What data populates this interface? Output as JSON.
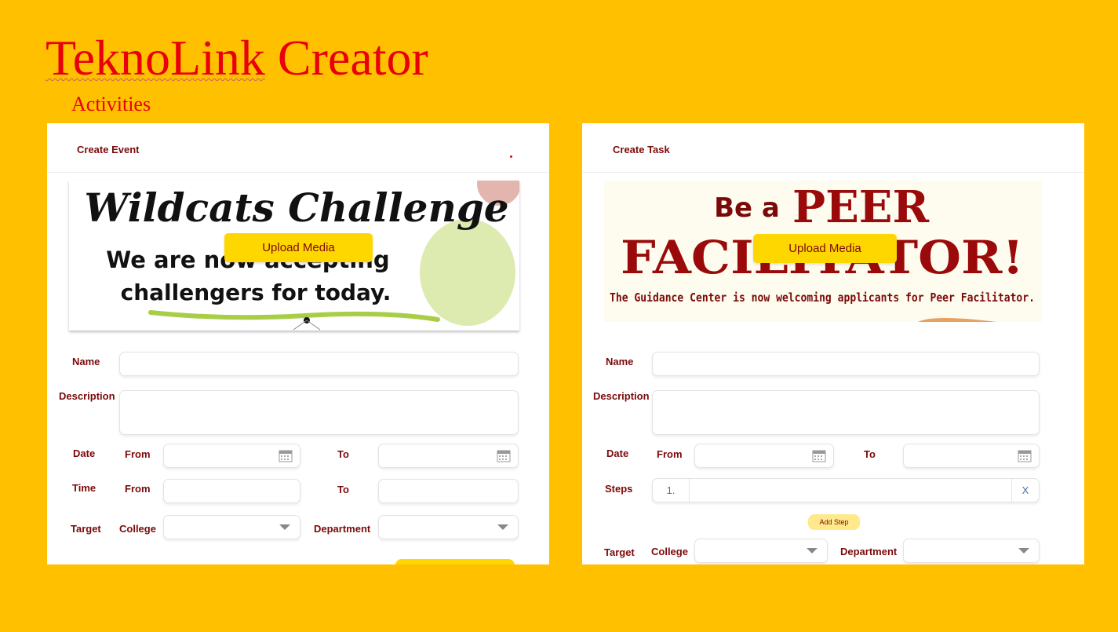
{
  "app": {
    "title_part1": "TeknoLink",
    "title_part2": " Creator",
    "section": "Activities"
  },
  "event_card": {
    "title": "Create Event",
    "banner": {
      "line1": "Wildcats Challenge",
      "line2": "We are now accepting",
      "line3": "challengers for today."
    },
    "upload_label": "Upload Media",
    "labels": {
      "name": "Name",
      "description": "Description",
      "date": "Date",
      "time": "Time",
      "from": "From",
      "to": "To",
      "target": "Target",
      "college": "College",
      "department": "Department"
    },
    "inputs": {
      "name": "",
      "description": "",
      "date_from": "",
      "date_to": "",
      "time_from": "",
      "time_to": "",
      "college": "",
      "department": ""
    }
  },
  "task_card": {
    "title": "Create Task",
    "banner": {
      "be_a": "Be a",
      "peer": "PEER",
      "facilitator": "FACILITATOR!",
      "subtitle": "The Guidance Center is now welcoming applicants for Peer Facilitator."
    },
    "upload_label": "Upload Media",
    "labels": {
      "name": "Name",
      "description": "Description",
      "date": "Date",
      "from": "From",
      "to": "To",
      "steps": "Steps",
      "target": "Target",
      "college": "College",
      "department": "Department"
    },
    "steps": [
      {
        "number": "1.",
        "text": "",
        "remove": "X"
      }
    ],
    "add_step_label": "Add Step",
    "inputs": {
      "name": "",
      "description": "",
      "date_from": "",
      "date_to": "",
      "college": "",
      "department": ""
    }
  },
  "colors": {
    "background": "#FFC000",
    "title_red": "#E8000B",
    "label_maroon": "#7A0A0A",
    "button_yellow": "#FFD700",
    "peer_red": "#9B0A0A"
  }
}
